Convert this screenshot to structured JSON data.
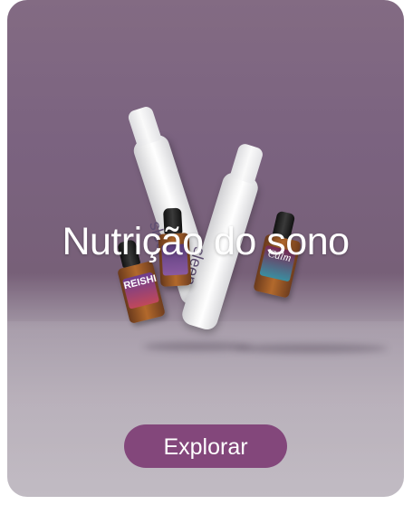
{
  "banner": {
    "title": "Nutrição do sono",
    "button_label": "Explorar",
    "colors": {
      "button": "#83477b",
      "background_top": "#836b83",
      "background_floor": "#b9b2bb",
      "title_text": "#ffffff"
    }
  },
  "products": {
    "spray_left_label": "sleep",
    "spray_right_label": "sleep",
    "dropper_left_label": "REISHI",
    "dropper_right_label": "Calm"
  }
}
